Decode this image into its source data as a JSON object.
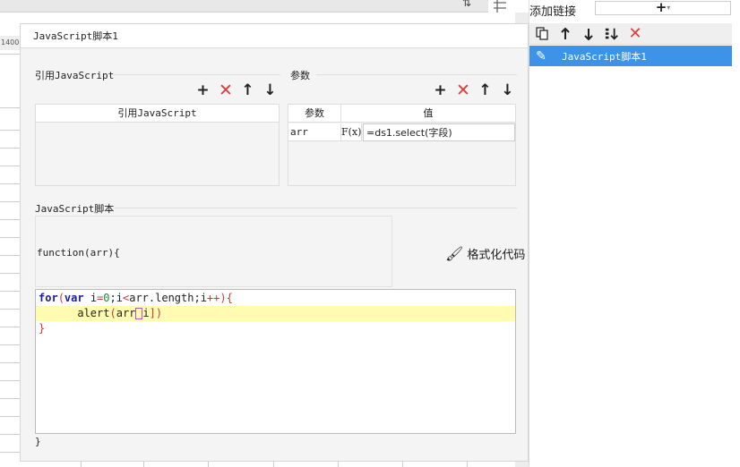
{
  "background": {
    "ruler_label": "1400"
  },
  "right_panel": {
    "title": "添加链接",
    "add_symbol": "+",
    "add_caret": "▾",
    "toolbar_icons": [
      "copy-icon",
      "arrow-up-icon",
      "arrow-down-icon",
      "sort-icon",
      "delete-icon"
    ],
    "items": [
      {
        "label": "JavaScript脚本1",
        "selected": true
      }
    ]
  },
  "dialog": {
    "title": "JavaScript脚本1",
    "ref_section": {
      "title": "引用JavaScript",
      "column_header": "引用JavaScript"
    },
    "params_section": {
      "title": "参数",
      "col_param": "参数",
      "col_value": "值",
      "rows": [
        {
          "name": "arr",
          "formula_icon": "F(x)",
          "value": "=ds1.select(字段)"
        }
      ]
    },
    "script_section": {
      "title": "JavaScript脚本",
      "header_line": "function(arr){",
      "format_label": "格式化代码",
      "footer_line": "}"
    },
    "code": {
      "line1_kw1": "for",
      "line1_p1": "(",
      "line1_kw2": "var",
      "line1_rest1": " i",
      "line1_eq": "=",
      "line1_zero": "0",
      "line1_rest2": ";i",
      "line1_lt": "<",
      "line1_rest3": "arr.length;i",
      "line1_pp": "++",
      "line1_close": "){",
      "line2_indent": "      ",
      "line2_call": "alert",
      "line2_open": "(",
      "line2_arg": "arr",
      "line2_idx_open": "[",
      "line2_idx": "i",
      "line2_idx_close": "]",
      "line2_close": ")",
      "line3": "}"
    },
    "colors": {
      "accent": "#3d93e8",
      "delete_red": "#e03a3a",
      "highlight": "#fffbb0"
    }
  }
}
